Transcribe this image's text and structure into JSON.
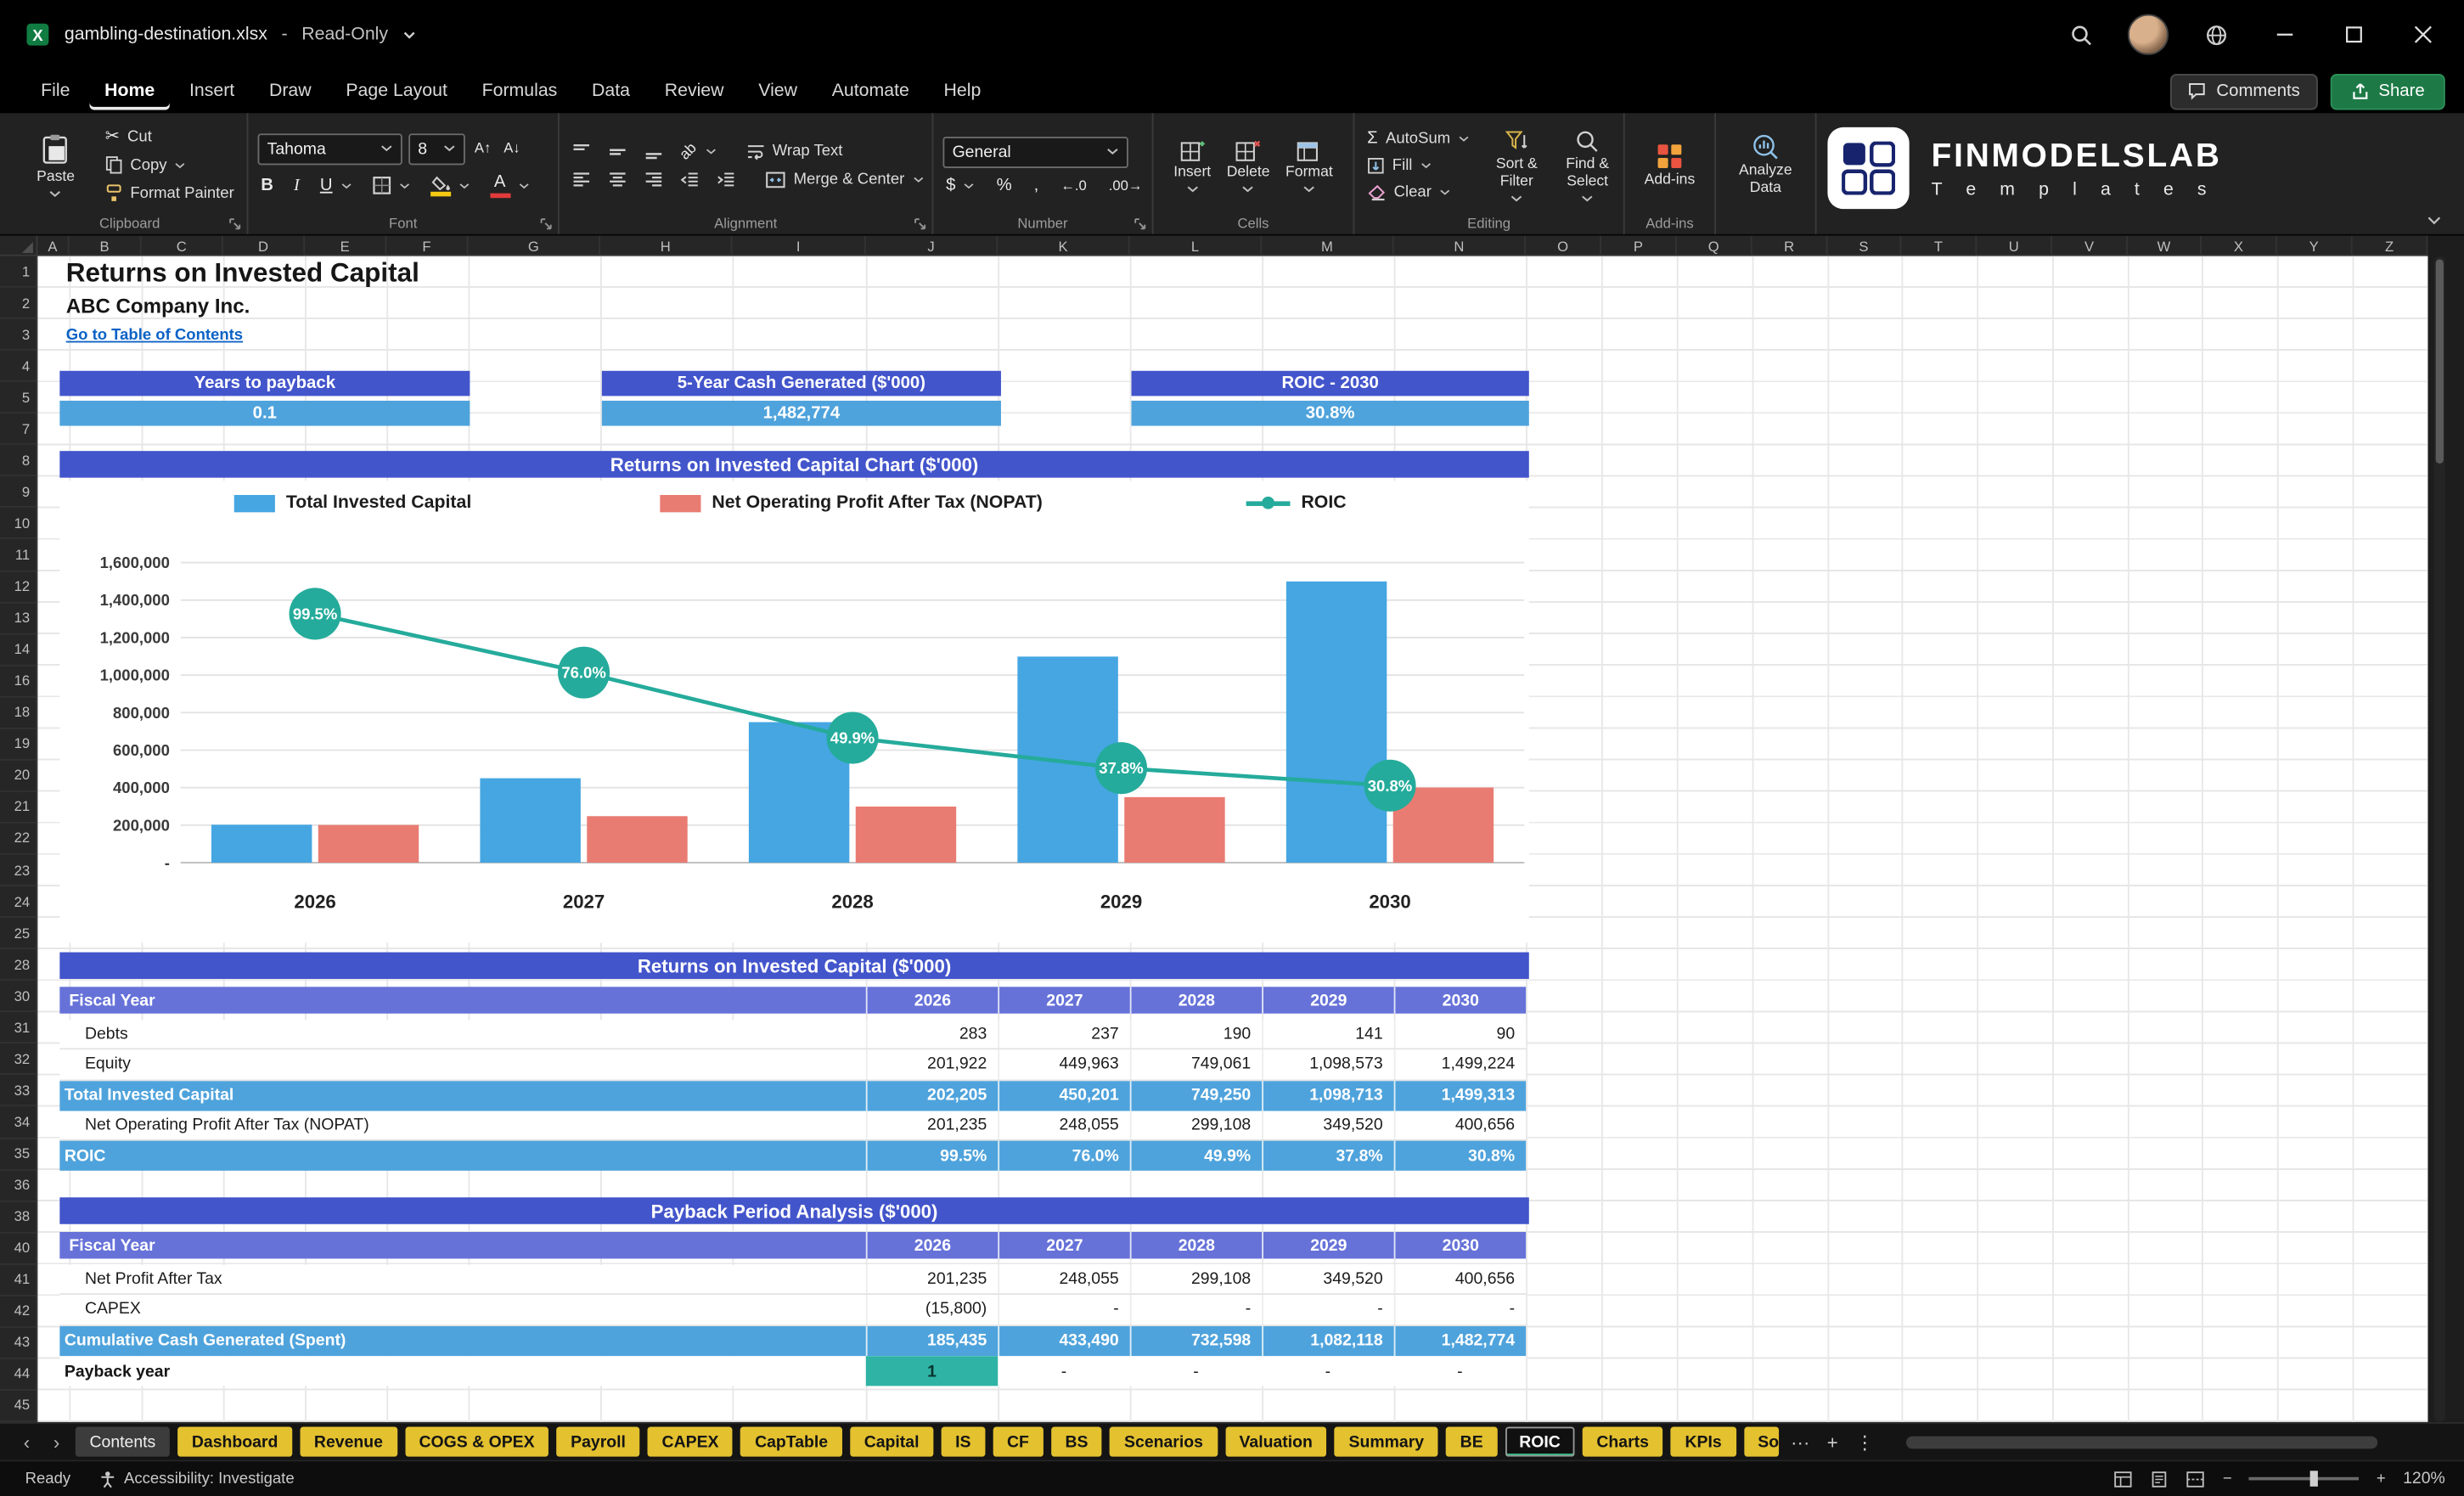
{
  "window": {
    "file_name": "gambling-destination.xlsx",
    "separator": "-",
    "mode": "Read-Only"
  },
  "menu": {
    "items": [
      "File",
      "Home",
      "Insert",
      "Draw",
      "Page Layout",
      "Formulas",
      "Data",
      "Review",
      "View",
      "Automate",
      "Help"
    ],
    "active_index": 1,
    "comments_label": "Comments",
    "share_label": "Share"
  },
  "ribbon": {
    "clipboard": {
      "label": "Clipboard",
      "paste": "Paste",
      "cut": "Cut",
      "copy": "Copy",
      "format_painter": "Format Painter"
    },
    "font": {
      "label": "Font",
      "family": "Tahoma",
      "size": "8"
    },
    "alignment": {
      "label": "Alignment",
      "wrap_text": "Wrap Text",
      "merge_center": "Merge & Center"
    },
    "number": {
      "label": "Number",
      "format": "General"
    },
    "cells": {
      "label": "Cells",
      "insert": "Insert",
      "delete": "Delete",
      "format": "Format"
    },
    "editing": {
      "label": "Editing",
      "autosum": "AutoSum",
      "fill": "Fill",
      "clear": "Clear",
      "sort_filter": "Sort & Filter",
      "find_select": "Find & Select"
    },
    "addins": {
      "label": "Add-ins",
      "button": "Add-ins",
      "analyze": "Analyze Data"
    },
    "brand": {
      "name": "FINMODELSLAB",
      "sub": "T e m p l a t e s"
    }
  },
  "glyphs": {
    "cut": "✂",
    "bold": "B",
    "italic": "I",
    "underline": "U",
    "grow_font": "A↑",
    "shrink_font": "A↓",
    "orientation": "ab",
    "sigma": "Σ",
    "dollar": "$",
    "percent": "%",
    "comma": ",",
    "increase_decimal": "←.0",
    "decrease_decimal": ".00→",
    "font_color": "A",
    "more_tabs": "···",
    "add_tab": "+",
    "tab_menu": "⋮",
    "nav_left": "‹",
    "nav_right": "›",
    "zoom_out": "−",
    "zoom_in": "+"
  },
  "sheet": {
    "columns": [
      "A",
      "B",
      "C",
      "D",
      "E",
      "F",
      "G",
      "H",
      "I",
      "J",
      "K",
      "L",
      "M",
      "N",
      "O",
      "P",
      "Q",
      "R",
      "S",
      "T",
      "U",
      "V",
      "W",
      "X",
      "Y",
      "Z"
    ],
    "rows": [
      1,
      2,
      3,
      4,
      5,
      7,
      8,
      9,
      10,
      11,
      12,
      13,
      14,
      16,
      18,
      19,
      20,
      21,
      22,
      23,
      24,
      25,
      28,
      30,
      31,
      32,
      33,
      34,
      35,
      36,
      38,
      40,
      41,
      42,
      43,
      44,
      45
    ],
    "title": "Returns on Invested Capital",
    "company": "ABC Company Inc.",
    "link": "Go to Table of Contents",
    "kpis": [
      {
        "label": "Years to payback",
        "value": "0.1"
      },
      {
        "label": "5-Year Cash Generated ($'000)",
        "value": "1,482,774"
      },
      {
        "label": "ROIC - 2030",
        "value": "30.8%"
      }
    ]
  },
  "chart_data": {
    "type": "combo",
    "title": "Returns on Invested Capital Chart ($'000)",
    "categories": [
      "2026",
      "2027",
      "2028",
      "2029",
      "2030"
    ],
    "series": [
      {
        "name": "Total Invested Capital",
        "kind": "bar",
        "color": "#45a6e2",
        "values": [
          202205,
          450201,
          749250,
          1098713,
          1499313
        ]
      },
      {
        "name": "Net Operating Profit After Tax (NOPAT)",
        "kind": "bar",
        "color": "#e97c72",
        "values": [
          201235,
          248055,
          299108,
          349520,
          400656
        ]
      },
      {
        "name": "ROIC",
        "kind": "line",
        "color": "#25ab9b",
        "values_percent": [
          99.5,
          76.0,
          49.9,
          37.8,
          30.8
        ],
        "point_labels": [
          "99.5%",
          "76.0%",
          "49.9%",
          "37.8%",
          "30.8%"
        ]
      }
    ],
    "ylim": [
      0,
      1600000
    ],
    "secondary_ylim": [
      0,
      125
    ],
    "yticks": [
      "1,600,000",
      "1,400,000",
      "1,200,000",
      "1,000,000",
      "800,000",
      "600,000",
      "400,000",
      "200,000",
      "-"
    ],
    "legend_position": "top",
    "grid": true
  },
  "tables": [
    {
      "header": "Returns on Invested Capital ($'000)",
      "fiscal_label": "Fiscal Year",
      "years": [
        "2026",
        "2027",
        "2028",
        "2029",
        "2030"
      ],
      "rows": [
        {
          "label": "Debts",
          "style": "plain",
          "values": [
            "283",
            "237",
            "190",
            "141",
            "90"
          ]
        },
        {
          "label": "Equity",
          "style": "plain",
          "values": [
            "201,922",
            "449,963",
            "749,061",
            "1,098,573",
            "1,499,224"
          ]
        },
        {
          "label": "Total Invested Capital",
          "style": "total",
          "values": [
            "202,205",
            "450,201",
            "749,250",
            "1,098,713",
            "1,499,313"
          ]
        },
        {
          "label": "Net Operating Profit After Tax (NOPAT)",
          "style": "plain",
          "values": [
            "201,235",
            "248,055",
            "299,108",
            "349,520",
            "400,656"
          ]
        },
        {
          "label": "ROIC",
          "style": "total",
          "values": [
            "99.5%",
            "76.0%",
            "49.9%",
            "37.8%",
            "30.8%"
          ]
        }
      ]
    },
    {
      "header": "Payback Period Analysis ($'000)",
      "fiscal_label": "Fi­scal Year",
      "years": [
        "2026",
        "2027",
        "2028",
        "2029",
        "2030"
      ],
      "rows": [
        {
          "label": "Net Profit After Tax",
          "style": "plain",
          "values": [
            "201,235",
            "248,055",
            "299,108",
            "349,520",
            "400,656"
          ]
        },
        {
          "label": "CAPEX",
          "style": "plain",
          "values": [
            "(15,800)",
            "-",
            "-",
            "-",
            "-"
          ]
        },
        {
          "label": "Cumulative Cash Generated (Spent)",
          "style": "total",
          "values": [
            "185,435",
            "433,490",
            "732,598",
            "1,082,118",
            "1,482,774"
          ]
        },
        {
          "label": "Payback year",
          "style": "payback",
          "values": [
            "1",
            "-",
            "-",
            "-",
            "-"
          ]
        }
      ]
    }
  ],
  "tabs": {
    "items": [
      {
        "label": "Contents",
        "style": "plain"
      },
      {
        "label": "Dashboard",
        "style": "yellow"
      },
      {
        "label": "Revenue",
        "style": "yellow"
      },
      {
        "label": "COGS & OPEX",
        "style": "yellow"
      },
      {
        "label": "Payroll",
        "style": "yellow"
      },
      {
        "label": "CAPEX",
        "style": "yellow"
      },
      {
        "label": "CapTable",
        "style": "yellow"
      },
      {
        "label": "Capital",
        "style": "yellow"
      },
      {
        "label": "IS",
        "style": "yellow"
      },
      {
        "label": "CF",
        "style": "yellow"
      },
      {
        "label": "BS",
        "style": "yellow"
      },
      {
        "label": "Scenarios",
        "style": "yellow"
      },
      {
        "label": "Valuation",
        "style": "yellow"
      },
      {
        "label": "Summary",
        "style": "yellow"
      },
      {
        "label": "BE",
        "style": "yellow"
      },
      {
        "label": "ROIC",
        "style": "active"
      },
      {
        "label": "Charts",
        "style": "yellow"
      },
      {
        "label": "KPIs",
        "style": "yellow"
      },
      {
        "label": "So",
        "style": "yellow",
        "truncated": true
      }
    ]
  },
  "status": {
    "ready": "Ready",
    "accessibility": "Accessibility: Investigate",
    "zoom": "120%"
  },
  "colors": {
    "header_blue": "#4355cb",
    "band_blue": "#4fa3dc",
    "fiscal_blue": "#6672d8",
    "payback_teal": "#2fb3a4",
    "tab_yellow": "#e3c12f",
    "link_blue": "#0b62c6",
    "bar_blue": "#45a6e2",
    "bar_salmon": "#e97c72",
    "line_teal": "#25ab9b",
    "share_green": "#1d7a46",
    "excel_green": "#107c41"
  }
}
